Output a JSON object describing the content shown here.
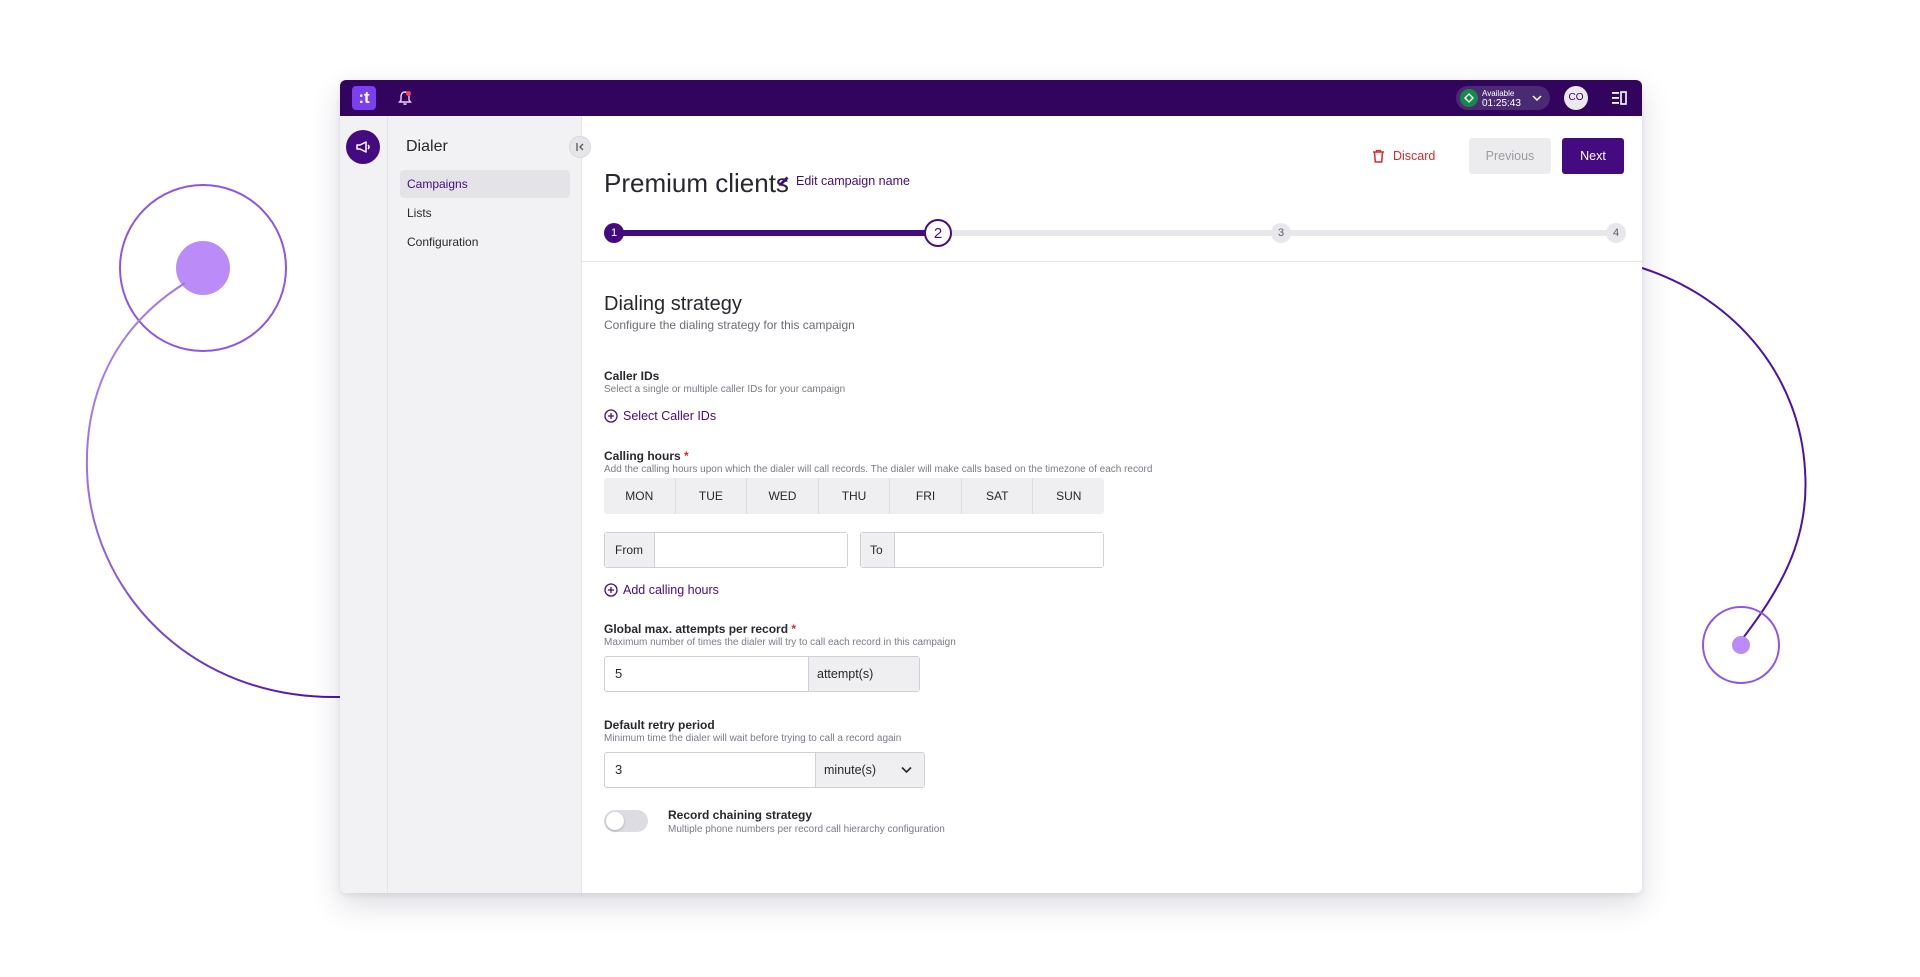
{
  "app": {
    "logo_glyph": ":t",
    "colors": {
      "topbar": "#32045e",
      "accent": "#440b81",
      "danger": "#d62b2b",
      "available": "#128a4a"
    }
  },
  "topbar": {
    "status_label": "Available",
    "status_timer": "01:25:43",
    "avatar_initials": "CO",
    "icons": [
      "notification-bell-icon",
      "status-chevron-icon",
      "panel-toggle-icon"
    ]
  },
  "nav": {
    "title": "Dialer",
    "items": [
      {
        "label": "Campaigns",
        "active": true
      },
      {
        "label": "Lists",
        "active": false
      },
      {
        "label": "Configuration",
        "active": false
      }
    ]
  },
  "header": {
    "campaign_name": "Premium clients",
    "edit_label": "Edit campaign name",
    "discard_label": "Discard",
    "previous_label": "Previous",
    "next_label": "Next"
  },
  "stepper": {
    "current": 2,
    "steps": [
      "1",
      "2",
      "3",
      "4"
    ]
  },
  "section": {
    "title": "Dialing strategy",
    "subtitle": "Configure the dialing strategy for this campaign"
  },
  "caller_ids": {
    "label": "Caller IDs",
    "help": "Select a single or multiple caller IDs for your campaign",
    "action": "Select Caller IDs"
  },
  "calling_hours": {
    "label": "Calling hours",
    "required_mark": "*",
    "help": "Add the calling hours upon which the dialer will call records. The dialer will make calls based on the timezone of each record",
    "days": [
      "MON",
      "TUE",
      "WED",
      "THU",
      "FRI",
      "SAT",
      "SUN"
    ],
    "from_label": "From",
    "from_value": "",
    "to_label": "To",
    "to_value": "",
    "add_action": "Add calling hours"
  },
  "max_attempts": {
    "label": "Global max. attempts per record",
    "required_mark": "*",
    "help": "Maximum number of times the dialer will try to call each record in this campaign",
    "value": "5",
    "unit": "attempt(s)"
  },
  "retry_period": {
    "label": "Default retry period",
    "help": "Minimum time the dialer will wait before trying to call a record again",
    "value": "3",
    "unit": "minute(s)"
  },
  "record_chaining": {
    "label": "Record chaining strategy",
    "help": "Multiple phone numbers per record call hierarchy configuration",
    "enabled": false
  }
}
